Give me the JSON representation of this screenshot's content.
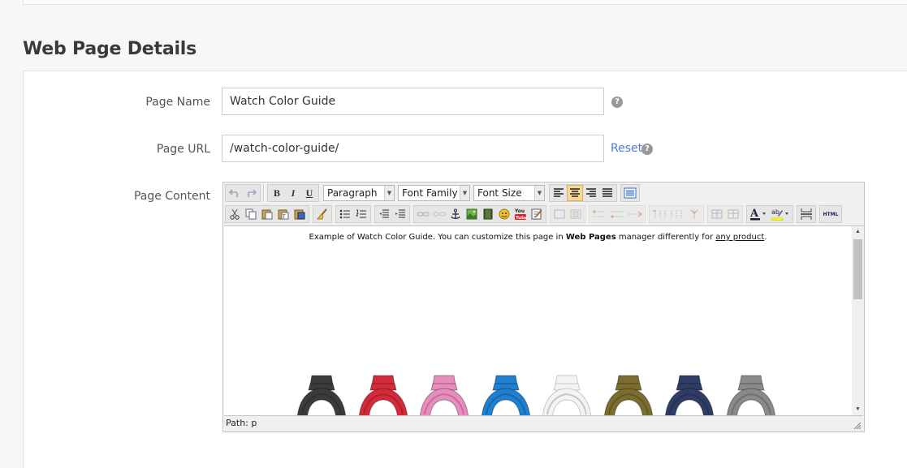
{
  "section": {
    "title": "Web Page Details"
  },
  "fields": {
    "page_name": {
      "label": "Page Name",
      "value": "Watch Color Guide",
      "help": "?"
    },
    "page_url": {
      "label": "Page URL",
      "value": "/watch-color-guide/",
      "reset": "Reset",
      "help": "?"
    },
    "page_content": {
      "label": "Page Content"
    }
  },
  "editor": {
    "format_select": "Paragraph",
    "font_family_select": "Font Family",
    "font_size_select": "Font Size",
    "bold": "B",
    "italic": "I",
    "underline": "U",
    "html_button": "HTML",
    "youtube_button": "You Tube",
    "content": {
      "pre": "Example of Watch Color Guide. You can customize this page in ",
      "bold": "Web Pages",
      "mid": " manager differently for ",
      "link": "any product",
      "post": "."
    },
    "path_label": "Path: p",
    "watch_colors": [
      "#3b3b3b",
      "#d42a3a",
      "#e98dbf",
      "#1f7fd0",
      "#f3f3f3",
      "#7a6d2e",
      "#2f3d66",
      "#8a8a8a"
    ]
  }
}
